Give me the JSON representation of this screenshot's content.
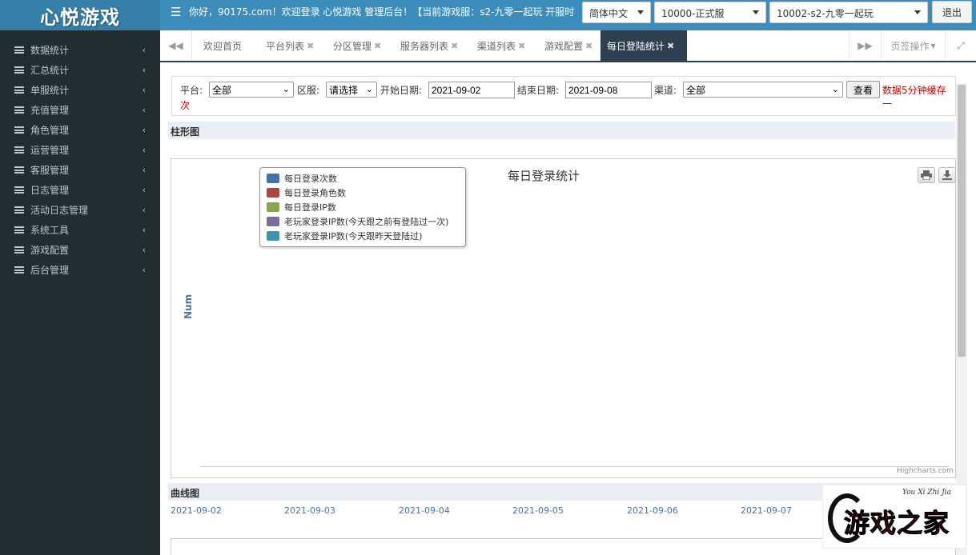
{
  "app": {
    "logo": "心悦游戏",
    "menu_icon": "hamburger-icon",
    "marquee": "你好，90175.com！欢迎登录 心悦游戏 管理后台！【当前游戏服：s2-九零一起玩 开服时",
    "language": "简体中文",
    "server_group": "10000-正式服",
    "server": "10002-s2-九零一起玩",
    "logout": "退出"
  },
  "sidebar": {
    "items": [
      {
        "label": "数据统计"
      },
      {
        "label": "汇总统计"
      },
      {
        "label": "单服统计"
      },
      {
        "label": "充值管理"
      },
      {
        "label": "角色管理"
      },
      {
        "label": "运营管理"
      },
      {
        "label": "客服管理"
      },
      {
        "label": "日志管理"
      },
      {
        "label": "活动日志管理"
      },
      {
        "label": "系统工具"
      },
      {
        "label": "游戏配置"
      },
      {
        "label": "后台管理"
      }
    ]
  },
  "tabs": {
    "items": [
      {
        "label": "欢迎首页",
        "closable": false
      },
      {
        "label": "平台列表",
        "closable": true
      },
      {
        "label": "分区管理",
        "closable": true
      },
      {
        "label": "服务器列表",
        "closable": true
      },
      {
        "label": "渠道列表",
        "closable": true
      },
      {
        "label": "游戏配置",
        "closable": true
      },
      {
        "label": "每日登陆统计",
        "closable": true,
        "active": true
      }
    ],
    "page_ops": "页签操作",
    "close_glyph": "✖"
  },
  "filters": {
    "platform_label": "平台:",
    "platform_value": "全部",
    "zone_label": "区服:",
    "zone_value": "请选择",
    "start_label": "开始日期:",
    "start_value": "2021-09-02",
    "end_label": "结束日期:",
    "end_value": "2021-09-08",
    "channel_label": "渠道:",
    "channel_value": "全部",
    "query_button": "查看",
    "cache_note_1": "数据5分钟缓存一",
    "cache_note_2": "次"
  },
  "bar_section": {
    "title": "柱形图",
    "chart_title": "每日登录统计",
    "y_label": "Num",
    "credits": "Highcharts.com",
    "legend": [
      {
        "name": "每日登录次数",
        "color": "#4572a7"
      },
      {
        "name": "每日登录角色数",
        "color": "#aa4643"
      },
      {
        "name": "每日登录IP数",
        "color": "#89a54e"
      },
      {
        "name": "老玩家登录IP数(今天跟之前有登陆过一次)",
        "color": "#80699b"
      },
      {
        "name": "老玩家登录IP数(今天跟昨天登陆过)",
        "color": "#3d96ae"
      }
    ]
  },
  "line_section": {
    "title": "曲线图",
    "dates": [
      "2021-09-02",
      "2021-09-03",
      "2021-09-04",
      "2021-09-05",
      "2021-09-06",
      "2021-09-07"
    ]
  },
  "watermark": {
    "script": "You Xi Zhi Jia",
    "text": "游戏之家"
  },
  "chart_data": {
    "type": "bar",
    "title": "每日登录统计",
    "ylabel": "Num",
    "xlabel": "",
    "categories": [],
    "series": [
      {
        "name": "每日登录次数",
        "values": []
      },
      {
        "name": "每日登录角色数",
        "values": []
      },
      {
        "name": "每日登录IP数",
        "values": []
      },
      {
        "name": "老玩家登录IP数(今天跟之前有登陆过一次)",
        "values": []
      },
      {
        "name": "老玩家登录IP数(今天跟昨天登陆过)",
        "values": []
      }
    ],
    "legend": "top-left",
    "grid": false
  }
}
